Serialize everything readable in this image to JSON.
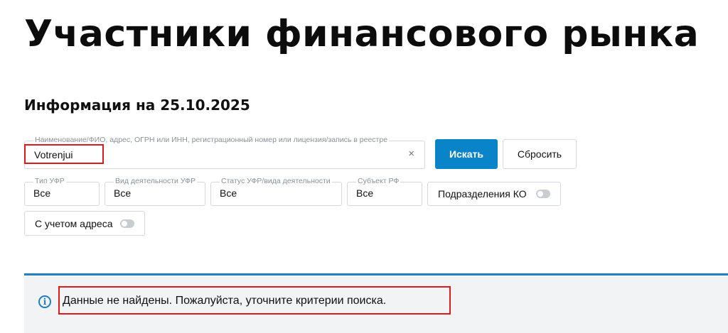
{
  "page": {
    "title": "Участники финансового рынка",
    "info_date": "Информация на 25.10.2025"
  },
  "search": {
    "label": "Наименование/ФИО, адрес, ОГРН или ИНН, регистрационный номер или лицензия/запись в реестре",
    "value": "Votrenjui",
    "clear_icon": "×",
    "search_button": "Искать",
    "reset_button": "Сбросить"
  },
  "filters": [
    {
      "label": "Тип УФР",
      "value": "Все"
    },
    {
      "label": "Вид деятельности УФР",
      "value": "Все"
    },
    {
      "label": "Статус УФР/вида деятельности",
      "value": "Все"
    },
    {
      "label": "Субъект РФ",
      "value": "Все"
    }
  ],
  "toggles": {
    "ko_divisions": "Подразделения КО",
    "with_address": "С учетом адреса"
  },
  "alert": {
    "icon": "i",
    "message": "Данные не найдены. Пожалуйста, уточните критерии поиска."
  },
  "colors": {
    "accent": "#0a84c9",
    "alert_border": "#1f7fc0",
    "highlight": "#e01a1a"
  }
}
